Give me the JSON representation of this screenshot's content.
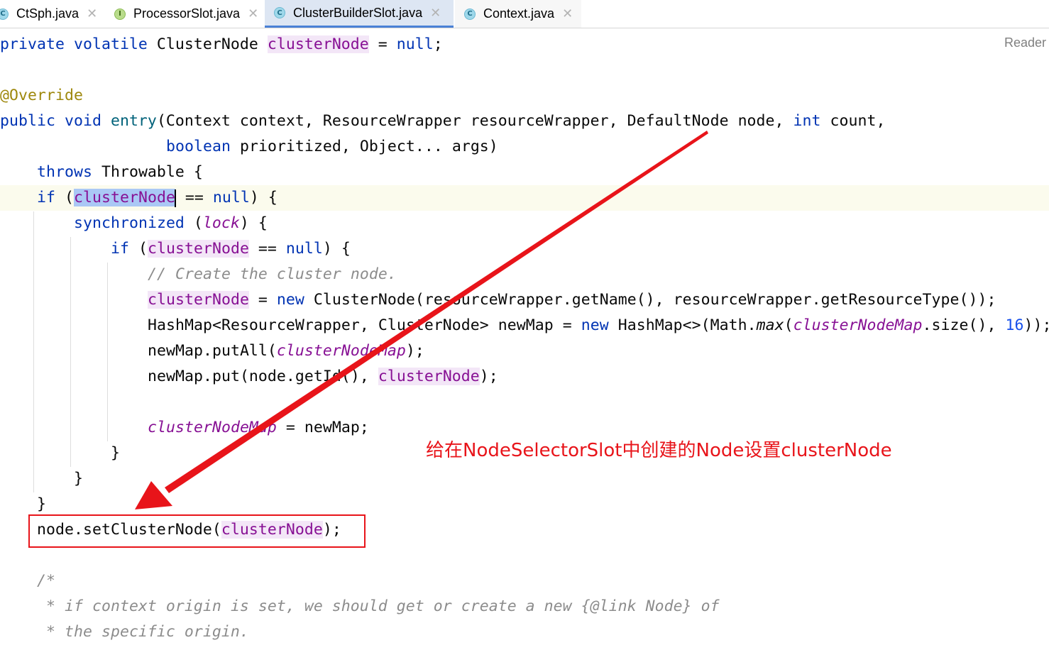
{
  "tabs": [
    {
      "name": "CtSph.java",
      "badge": "C",
      "active": false
    },
    {
      "name": "ProcessorSlot.java",
      "badge": "I",
      "active": false
    },
    {
      "name": "ClusterBuilderSlot.java",
      "badge": "C",
      "active": true
    },
    {
      "name": "Context.java",
      "badge": "C",
      "active": false
    }
  ],
  "close_glyph": "✕",
  "reader_mode": "Reader",
  "code": {
    "l1": {
      "kw1": "private",
      "kw2": "volatile",
      "type": "ClusterNode",
      "field": "clusterNode",
      "eq": "=",
      "val": "null",
      "semi": ";"
    },
    "l2": {
      "annotation": "@Override"
    },
    "l3": {
      "kw1": "public",
      "kw2": "void",
      "method": "entry",
      "params": "(Context context, ResourceWrapper resourceWrapper, DefaultNode node, ",
      "kw3": "int",
      "rest": " count,"
    },
    "l4": {
      "kw": "boolean",
      "rest": " prioritized, Object... args)"
    },
    "l5": {
      "kw": "throws",
      "rest": " Throwable {"
    },
    "l6": {
      "kw": "if",
      "open": " (",
      "field": "clusterNode",
      "eq": " == ",
      "val": "null",
      "close": ") {"
    },
    "l7": {
      "kw": "synchronized",
      "open": " (",
      "lock": "lock",
      "close": ") {"
    },
    "l8": {
      "kw": "if",
      "open": " (",
      "field": "clusterNode",
      "eq": " == ",
      "val": "null",
      "close": ") {"
    },
    "l9": {
      "comment": "// Create the cluster node."
    },
    "l10": {
      "field": "clusterNode",
      "eq": " = ",
      "kw": "new",
      "rest": " ClusterNode(resourceWrapper.getName(), resourceWrapper.getResourceType());"
    },
    "l11": {
      "a": "HashMap<ResourceWrapper, ClusterNode> newMap = ",
      "kw": "new",
      "b": " HashMap<>(Math.",
      "method": "max",
      "c": "(",
      "field": "clusterNodeMap",
      "d": ".size(), ",
      "num": "16",
      "e": "));"
    },
    "l12": {
      "a": "newMap.putAll(",
      "field": "clusterNodeMap",
      "b": ");"
    },
    "l13": {
      "a": "newMap.put(node.getId(), ",
      "field": "clusterNode",
      "b": ");"
    },
    "l14": {
      "field": "clusterNodeMap",
      "rest": " = newMap;"
    },
    "l15": {
      "brace": "}"
    },
    "l16": {
      "brace": "}"
    },
    "l17": {
      "brace": "}"
    },
    "l18": {
      "a": "node.setClusterNode(",
      "field": "clusterNode",
      "b": ");"
    },
    "l19": {
      "comment": "/*"
    },
    "l20": {
      "comment": " * if context origin is set, we should get or create a new {@link Node} of"
    },
    "l21": {
      "comment": " * the specific origin."
    }
  },
  "annotation_text": "给在NodeSelectorSlot中创建的Node设置clusterNode",
  "colors": {
    "keyword": "#0033b3",
    "field": "#871094",
    "annotation": "#9e880d",
    "number": "#1750eb",
    "comment": "#8c8c8c",
    "red": "#e8141a",
    "selection": "#aac8f5"
  }
}
